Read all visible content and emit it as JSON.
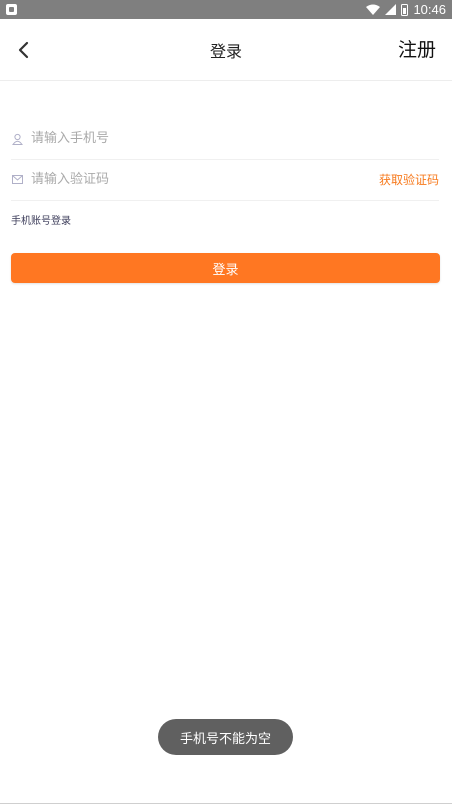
{
  "status_bar": {
    "time": "10:46",
    "icons": [
      "notification-icon",
      "wifi-icon",
      "cell-signal-icon",
      "battery-icon"
    ]
  },
  "nav": {
    "title": "登录",
    "register_label": "注册",
    "back_icon": "chevron-left-icon"
  },
  "form": {
    "phone": {
      "placeholder": "请输入手机号",
      "value": "",
      "icon": "user-icon"
    },
    "code": {
      "placeholder": "请输入验证码",
      "value": "",
      "icon": "mail-icon"
    },
    "get_code_label": "获取验证码",
    "switch_mode_label": "手机账号登录",
    "submit_label": "登录"
  },
  "toast": {
    "message": "手机号不能为空"
  },
  "colors": {
    "accent": "#ff7722",
    "accent_text": "#f77a1d",
    "status_bar": "#7f7f7f",
    "toast_bg": "#606060"
  }
}
